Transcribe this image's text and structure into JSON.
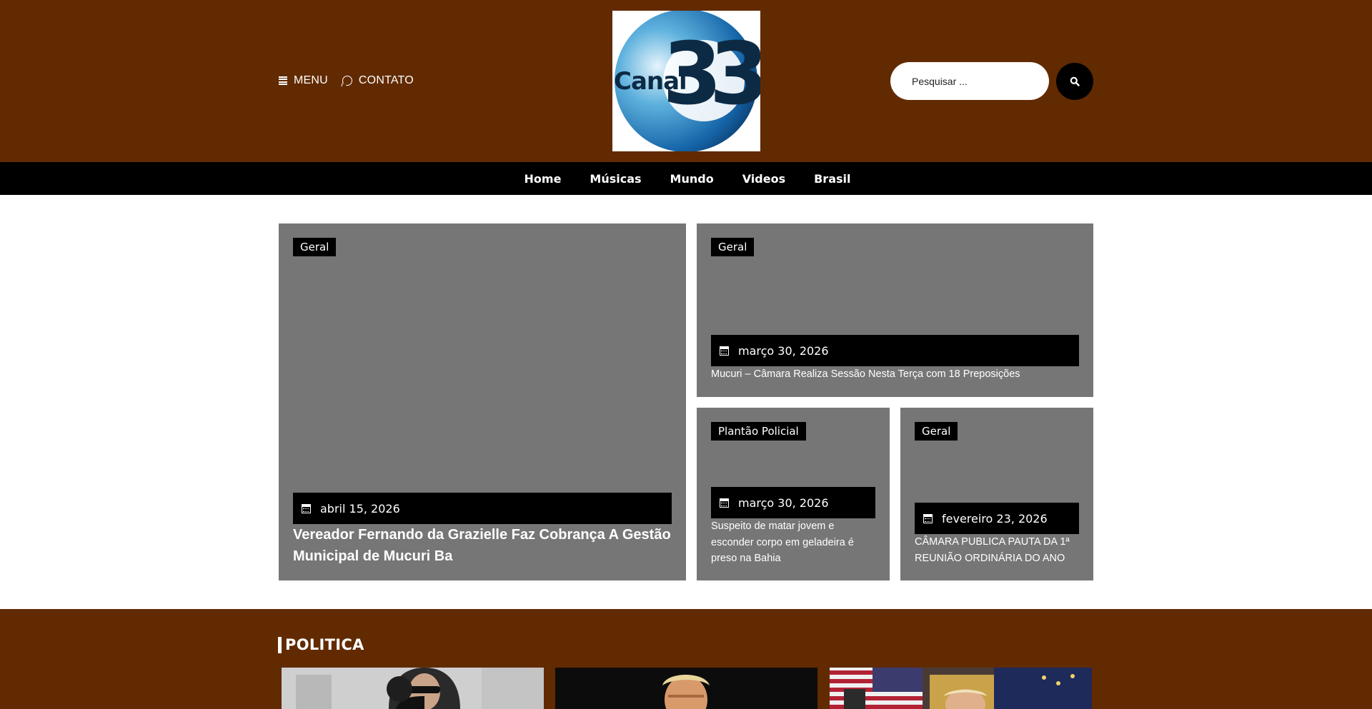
{
  "header": {
    "menu_label": "MENU",
    "contact_label": "CONTATO",
    "logo": {
      "text_canal": "Canal",
      "text_number": "33"
    },
    "search_placeholder": "Pesquisar ..."
  },
  "nav": {
    "items": [
      "Home",
      "Músicas",
      "Mundo",
      "Videos",
      "Brasil"
    ]
  },
  "featured": {
    "main": {
      "category": "Geral",
      "date": "abril 15, 2026",
      "title": "Vereador Fernando da Grazielle Faz Cobrança A Gestão Municipal de Mucuri Ba"
    },
    "top_right": {
      "category": "Geral",
      "date": "março 30, 2026",
      "title": "Mucuri – Câmara Realiza Sessão Nesta Terça com 18 Preposições"
    },
    "bottom_left": {
      "category": "Plantão Policial",
      "date": "março 30, 2026",
      "title": "Suspeito de matar jovem e esconder corpo em geladeira é preso na Bahia"
    },
    "bottom_right": {
      "category": "Geral",
      "date": "fevereiro 23, 2026",
      "title": "CÂMARA PUBLICA PAUTA DA 1ª REUNIÃO ORDINÁRIA DO ANO"
    }
  },
  "section": {
    "title": "POLITICA"
  },
  "colors": {
    "header_bg": "#622a00",
    "nav_bg": "#000000",
    "card_bg": "#767676",
    "logo_blue": "#1a73b8",
    "logo_dark": "#0d2a45"
  },
  "icons": {
    "menu": "hamburger-icon",
    "contact": "whatsapp-icon",
    "search": "search-icon",
    "date": "calendar-icon"
  }
}
